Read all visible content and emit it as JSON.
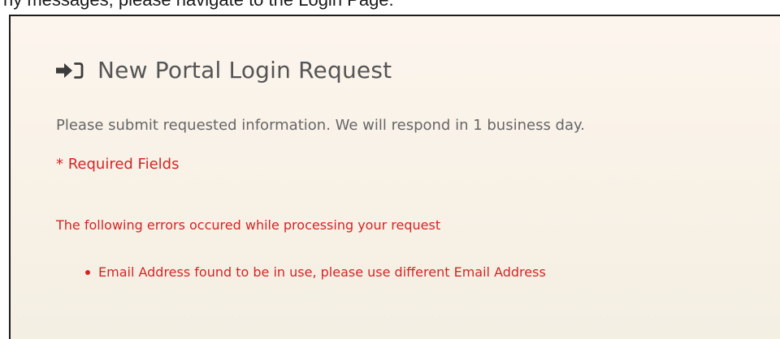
{
  "top_strip": {
    "text": "ny messages, please navigate to the Login Page."
  },
  "form": {
    "title": "New Portal Login Request",
    "title_icon": "sign-in-icon",
    "intro": "Please submit requested information. We will respond in 1 business day.",
    "required_note": "* Required Fields"
  },
  "errors": {
    "heading": "The following errors occured while processing your request",
    "items": [
      "Email Address found to be in use, please use different Email Address"
    ]
  },
  "colors": {
    "error": "#d62424",
    "title": "#555555",
    "body_text": "#666666",
    "panel_background": "#faf3ea",
    "border": "#1c1c1c"
  }
}
